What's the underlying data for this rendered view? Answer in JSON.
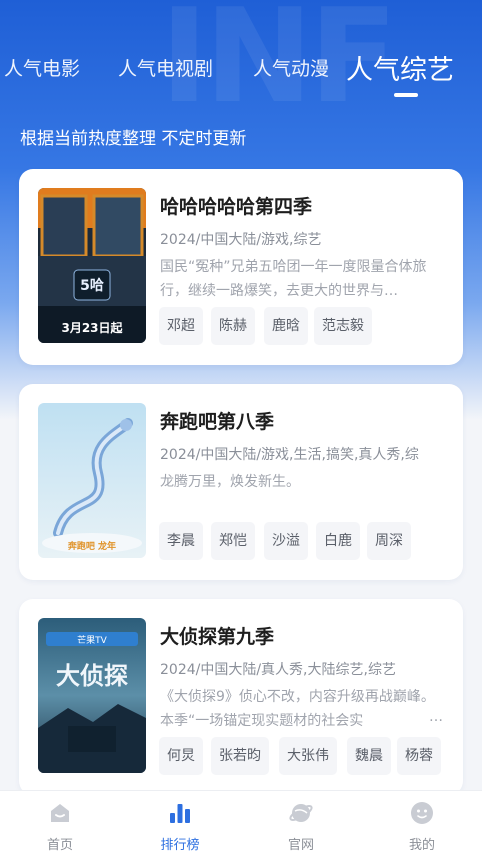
{
  "tabs": [
    {
      "label": "人气电影"
    },
    {
      "label": "人气电视剧"
    },
    {
      "label": "人气动漫"
    },
    {
      "label": "人气综艺"
    }
  ],
  "active_tab": 3,
  "subtitle": "根据当前热度整理 不定时更新",
  "shows": [
    {
      "title": "哈哈哈哈哈第四季",
      "meta": "2024/中国大陆/游戏,综艺",
      "description": "国民“冤种”兄弟五哈团一年一度限量合体旅行，继续一路爆笑，去更大的世界与…",
      "poster_caption": "3月23日起",
      "poster_badge": "5哈",
      "cast": [
        "邓超",
        "陈赫",
        "鹿晗",
        "范志毅"
      ]
    },
    {
      "title": "奔跑吧第八季",
      "meta": "2024/中国大陆/游戏,生活,搞笑,真人秀,综",
      "description": "龙腾万里，焕发新生。",
      "poster_caption": "奔跑吧 龙年",
      "cast": [
        "李晨",
        "郑恺",
        "沙溢",
        "白鹿",
        "周深"
      ]
    },
    {
      "title": "大侦探第九季",
      "meta": "2024/中国大陆/真人秀,大陆综艺,综艺",
      "description": "《大侦探9》侦心不改，内容升级再战巅峰。本季“一场锚定现实题材的社会实",
      "description_more": "…",
      "poster_caption": "大侦探",
      "poster_banner": "芒果TV",
      "cast": [
        "何炅",
        "张若昀",
        "大张伟",
        "魏晨",
        "杨蓉"
      ]
    }
  ],
  "tabbar": [
    {
      "label": "首页",
      "icon": "home-icon"
    },
    {
      "label": "排行榜",
      "icon": "ranking-icon"
    },
    {
      "label": "官网",
      "icon": "planet-icon"
    },
    {
      "label": "我的",
      "icon": "profile-icon"
    }
  ],
  "colors": {
    "accent": "#2d6fe0",
    "hero_top": "#1f5fd6",
    "background": "#f3f5f9"
  }
}
